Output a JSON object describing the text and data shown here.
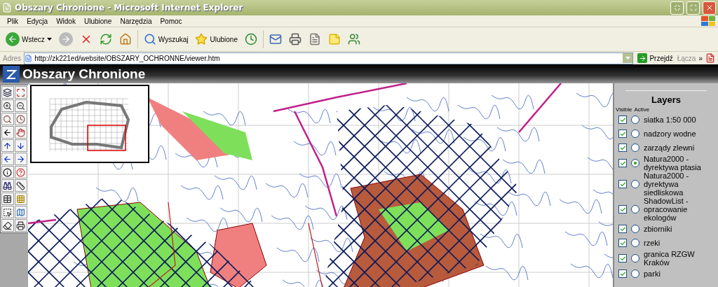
{
  "window": {
    "title": "Obszary Chronione - Microsoft Internet Explorer"
  },
  "menu": [
    "Plik",
    "Edycja",
    "Widok",
    "Ulubione",
    "Narzędzia",
    "Pomoc"
  ],
  "toolbar": {
    "back_label": "Wstecz",
    "forward_disabled": true,
    "search_label": "Wyszukaj",
    "favorites_label": "Ulubione"
  },
  "address_bar": {
    "label": "Adres",
    "url": "http://zk221ed/website/OBSZARY_OCHRONNE/viewer.htm",
    "go_label": "Przejdź",
    "links_label": "Łącza",
    "more": "»"
  },
  "app": {
    "title": "Obszary Chronione"
  },
  "layers_panel": {
    "title": "Layers",
    "visible_header": "Visible",
    "active_header": "Active",
    "layers": [
      {
        "name": "siatka 1:50 000",
        "visible": true,
        "selected": false
      },
      {
        "name": "nadzory wodne",
        "visible": true,
        "selected": false
      },
      {
        "name": "zarządy zlewni",
        "visible": true,
        "selected": false
      },
      {
        "name": "Natura2000 - dyrektywa ptasia",
        "visible": true,
        "selected": true
      },
      {
        "name": "Natura2000 - dyrektywa siedliskowa",
        "visible": true,
        "selected": false
      },
      {
        "name": "ShadowList - opracowanie ekologów",
        "visible": true,
        "selected": false
      },
      {
        "name": "zbiorniki",
        "visible": true,
        "selected": false
      },
      {
        "name": "rzeki",
        "visible": true,
        "selected": false
      },
      {
        "name": "granica RZGW Kraków",
        "visible": true,
        "selected": false
      },
      {
        "name": "parki",
        "visible": true,
        "selected": false
      }
    ]
  }
}
